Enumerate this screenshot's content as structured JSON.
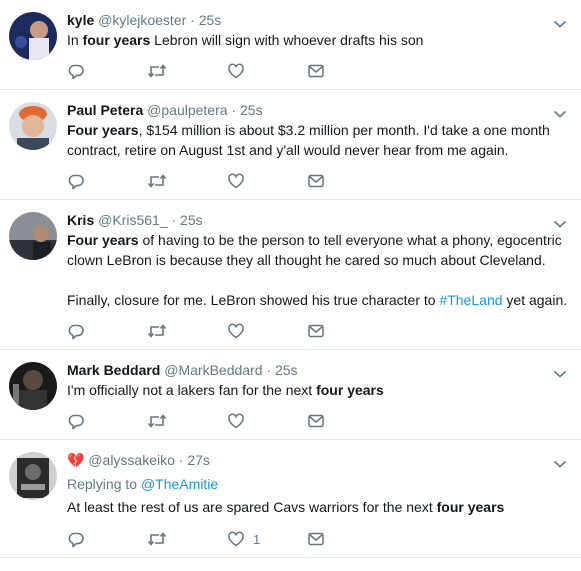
{
  "tweets": [
    {
      "name": "kyle",
      "handle": "@kylejkoester",
      "time": "25s",
      "lines": [
        [
          {
            "t": "In "
          },
          {
            "t": "four years",
            "b": true
          },
          {
            "t": " Lebron will sign with whoever drafts his son"
          }
        ]
      ],
      "like_count": ""
    },
    {
      "name": "Paul Petera",
      "handle": "@paulpetera",
      "time": "25s",
      "lines": [
        [
          {
            "t": "Four years",
            "b": true
          },
          {
            "t": ", $154 million is about $3.2 million per month. I'd take a one month"
          }
        ],
        [
          {
            "t": "contract, retire on August 1st and y'all would never hear from me again."
          }
        ]
      ],
      "like_count": ""
    },
    {
      "name": "Kris",
      "handle": "@Kris561_",
      "time": "25s",
      "lines": [
        [
          {
            "t": "Four years",
            "b": true
          },
          {
            "t": " of having to be the person to tell everyone what a phony, egocentric"
          }
        ],
        [
          {
            "t": "clown LeBron is because they all thought he cared so much about Cleveland."
          }
        ],
        [
          {
            "t": ""
          }
        ],
        [
          {
            "t": "Finally, closure for me.  LeBron showed his true character to "
          },
          {
            "t": "#TheLand",
            "link": true
          },
          {
            "t": " yet again."
          }
        ]
      ],
      "like_count": ""
    },
    {
      "name": "Mark Beddard",
      "handle": "@MarkBeddard",
      "time": "25s",
      "lines": [
        [
          {
            "t": "I'm officially not a lakers fan for the next "
          },
          {
            "t": "four years",
            "b": true
          }
        ]
      ],
      "like_count": ""
    },
    {
      "name": "💔",
      "handle": "@alyssakeiko",
      "time": "27s",
      "reply_prefix": "Replying to ",
      "reply_to": "@TheAmitie",
      "lines": [
        [
          {
            "t": "At least the rest of us are spared Cavs warriors for the next "
          },
          {
            "t": "four years",
            "b": true
          }
        ]
      ],
      "like_count": "1"
    }
  ],
  "icons": {
    "reply": "reply-icon",
    "retweet": "retweet-icon",
    "like": "heart-icon",
    "dm": "envelope-icon",
    "more": "chevron-down-icon"
  },
  "colors": {
    "link": "#1b95e0",
    "secondary": "#657786",
    "text": "#14171a",
    "divider": "#e6ecf0",
    "heart": "#e0245e"
  }
}
